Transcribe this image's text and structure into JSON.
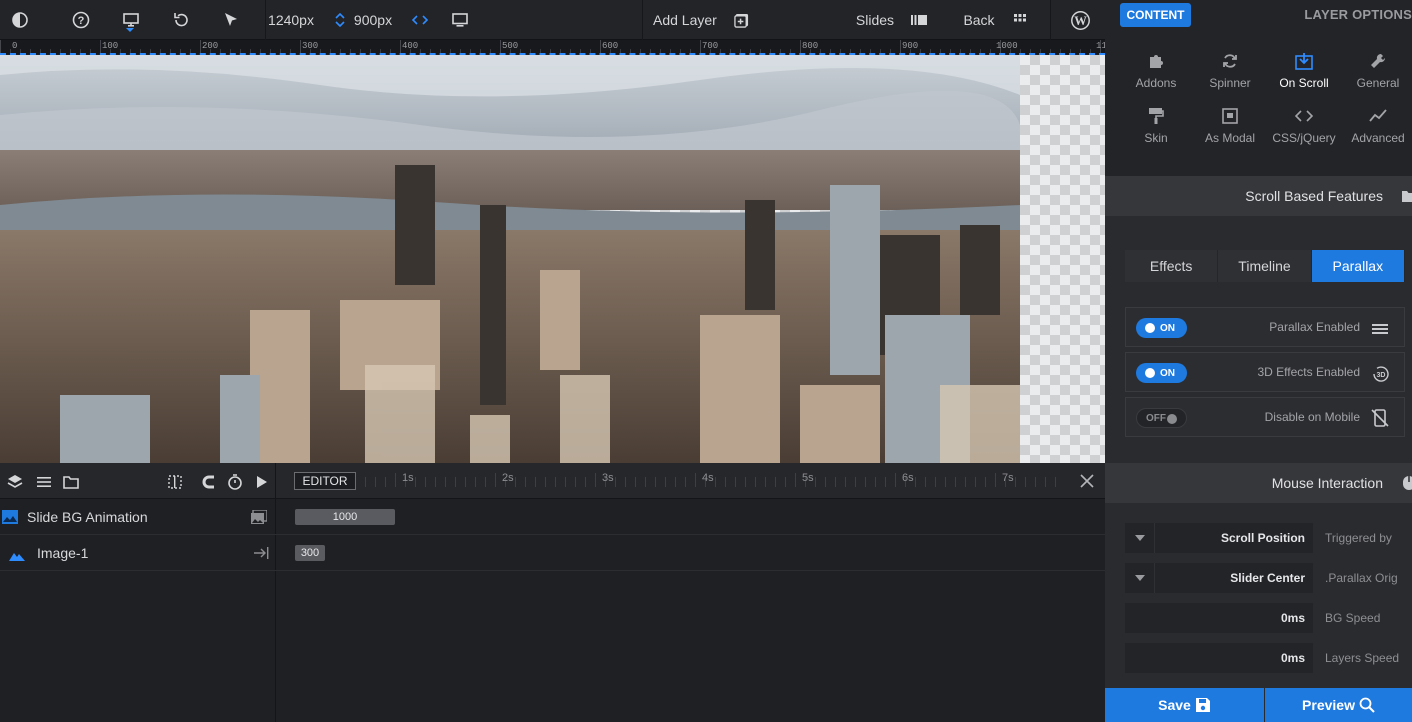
{
  "toolbar": {
    "icons": [
      "contrast-icon",
      "help-icon",
      "desktop-icon",
      "undo-icon",
      "pointer-icon",
      "expand-icon",
      "monitor-icon",
      "add-layer-icon",
      "slides-icon",
      "grid-icon",
      "wordpress-icon"
    ],
    "width_value": "1240px",
    "height_value": "900px",
    "add_layer_label": "Add Layer",
    "slides_label": "Slides",
    "back_label": "Back"
  },
  "ruler": {
    "labels": [
      "0",
      "100",
      "200",
      "300",
      "400",
      "500",
      "600",
      "700",
      "800",
      "900",
      "1000",
      "11"
    ]
  },
  "stage": {
    "image_alt": "City skyline aerial photo"
  },
  "timeline": {
    "editor_label": "EDITOR",
    "seconds": [
      "1s",
      "2s",
      "3s",
      "4s",
      "5s",
      "6s",
      "7s"
    ],
    "layers": [
      {
        "name": "Slide BG Animation",
        "bar_value": "1000"
      },
      {
        "name": "Image-1",
        "bar_value": "300"
      }
    ]
  },
  "panel": {
    "content_label": "CONTENT",
    "layer_options_label": "LAYER OPTIONS",
    "options": [
      {
        "label": "Addons",
        "icon": "puzzle-icon"
      },
      {
        "label": "Spinner",
        "icon": "spinner-icon"
      },
      {
        "label": "On Scroll",
        "icon": "on-scroll-icon",
        "active": true
      },
      {
        "label": "General",
        "icon": "wrench-icon"
      },
      {
        "label": "Skin",
        "icon": "paint-roller-icon"
      },
      {
        "label": "As Modal",
        "icon": "modal-icon"
      },
      {
        "label": "CSS/jQuery",
        "icon": "code-icon"
      },
      {
        "label": "Advanced",
        "icon": "chart-line-icon"
      }
    ],
    "scroll_section_title": "Scroll Based Features",
    "tabs": [
      "Effects",
      "Timeline",
      "Parallax"
    ],
    "active_tab": "Parallax",
    "toggles": [
      {
        "state": "ON",
        "label": "Parallax Enabled",
        "icon": "menu-lines-icon"
      },
      {
        "state": "ON",
        "label": "3D Effects Enabled",
        "icon": "3d-rotate-icon"
      },
      {
        "state": "OFF",
        "label": "Disable on Mobile",
        "icon": "no-mobile-icon"
      }
    ],
    "mouse_section_title": "Mouse Interaction",
    "fields": [
      {
        "value": "Scroll Position",
        "label": "Triggered by",
        "dropdown": true
      },
      {
        "value": "Slider Center",
        "label": ".Parallax Orig",
        "dropdown": true
      },
      {
        "value": "0ms",
        "label": "BG Speed",
        "dropdown": false
      },
      {
        "value": "0ms",
        "label": "Layers Speed",
        "dropdown": false
      }
    ],
    "save_label": "Save",
    "preview_label": "Preview"
  },
  "colors": {
    "accent": "#1f7ae0",
    "background": "#1f2024",
    "panel": "#2a2b2f"
  }
}
